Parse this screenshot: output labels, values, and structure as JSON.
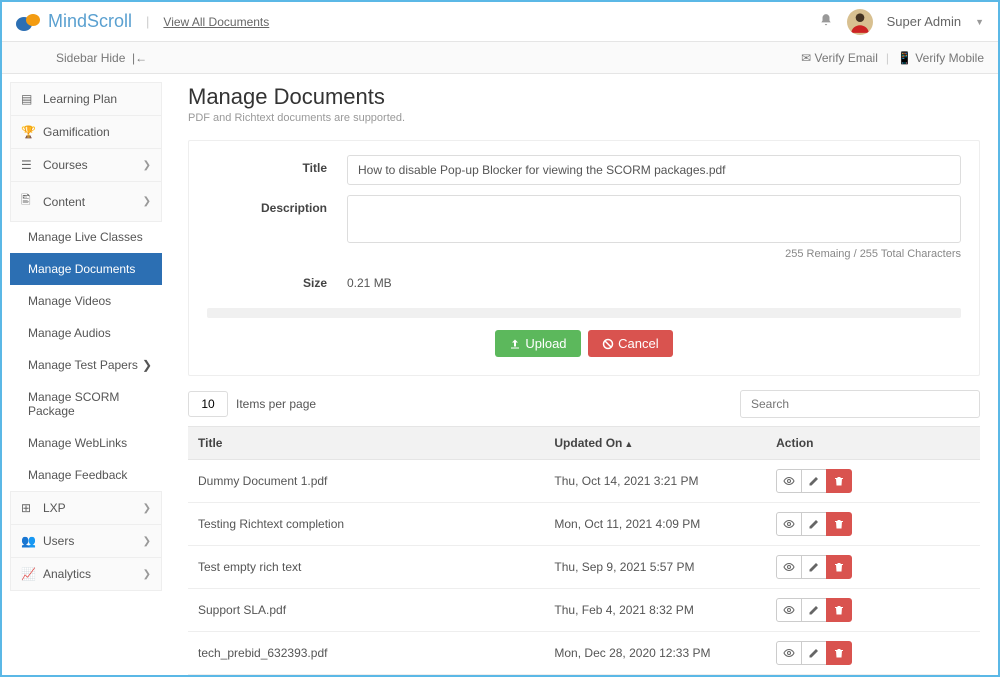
{
  "brand": "MindScroll",
  "header": {
    "view_all": "View All Documents",
    "user_name": "Super Admin"
  },
  "secondbar": {
    "sidebar_hide": "Sidebar Hide",
    "verify_email": "Verify Email",
    "verify_mobile": "Verify Mobile"
  },
  "sidebar": {
    "learning_plan": "Learning Plan",
    "gamification": "Gamification",
    "courses": "Courses",
    "content": "Content",
    "subs": {
      "live": "Manage Live Classes",
      "docs": "Manage Documents",
      "videos": "Manage Videos",
      "audios": "Manage Audios",
      "tests": "Manage Test Papers",
      "scorm": "Manage SCORM Package",
      "weblinks": "Manage WebLinks",
      "feedback": "Manage Feedback"
    },
    "lxp": "LXP",
    "users": "Users",
    "analytics": "Analytics"
  },
  "page": {
    "title": "Manage Documents",
    "subtitle": "PDF and Richtext documents are supported."
  },
  "form": {
    "title_lbl": "Title",
    "title_val": "How to disable Pop-up Blocker for viewing the SCORM packages.pdf",
    "desc_lbl": "Description",
    "char_count": "255 Remaing / 255 Total Characters",
    "size_lbl": "Size",
    "size_val": "0.21 MB",
    "upload": "Upload",
    "cancel": "Cancel"
  },
  "list": {
    "items_per_page": "10",
    "ipp_label": "Items per page",
    "search_ph": "Search",
    "col_title": "Title",
    "col_updated": "Updated On",
    "col_action": "Action",
    "rows": [
      {
        "title": "Dummy Document 1.pdf",
        "updated": "Thu, Oct 14, 2021 3:21 PM"
      },
      {
        "title": "Testing Richtext completion",
        "updated": "Mon, Oct 11, 2021 4:09 PM"
      },
      {
        "title": "Test empty rich text",
        "updated": "Thu, Sep 9, 2021 5:57 PM"
      },
      {
        "title": "Support SLA.pdf",
        "updated": "Thu, Feb 4, 2021 8:32 PM"
      },
      {
        "title": "tech_prebid_632393.pdf",
        "updated": "Mon, Dec 28, 2020 12:33 PM"
      }
    ]
  }
}
